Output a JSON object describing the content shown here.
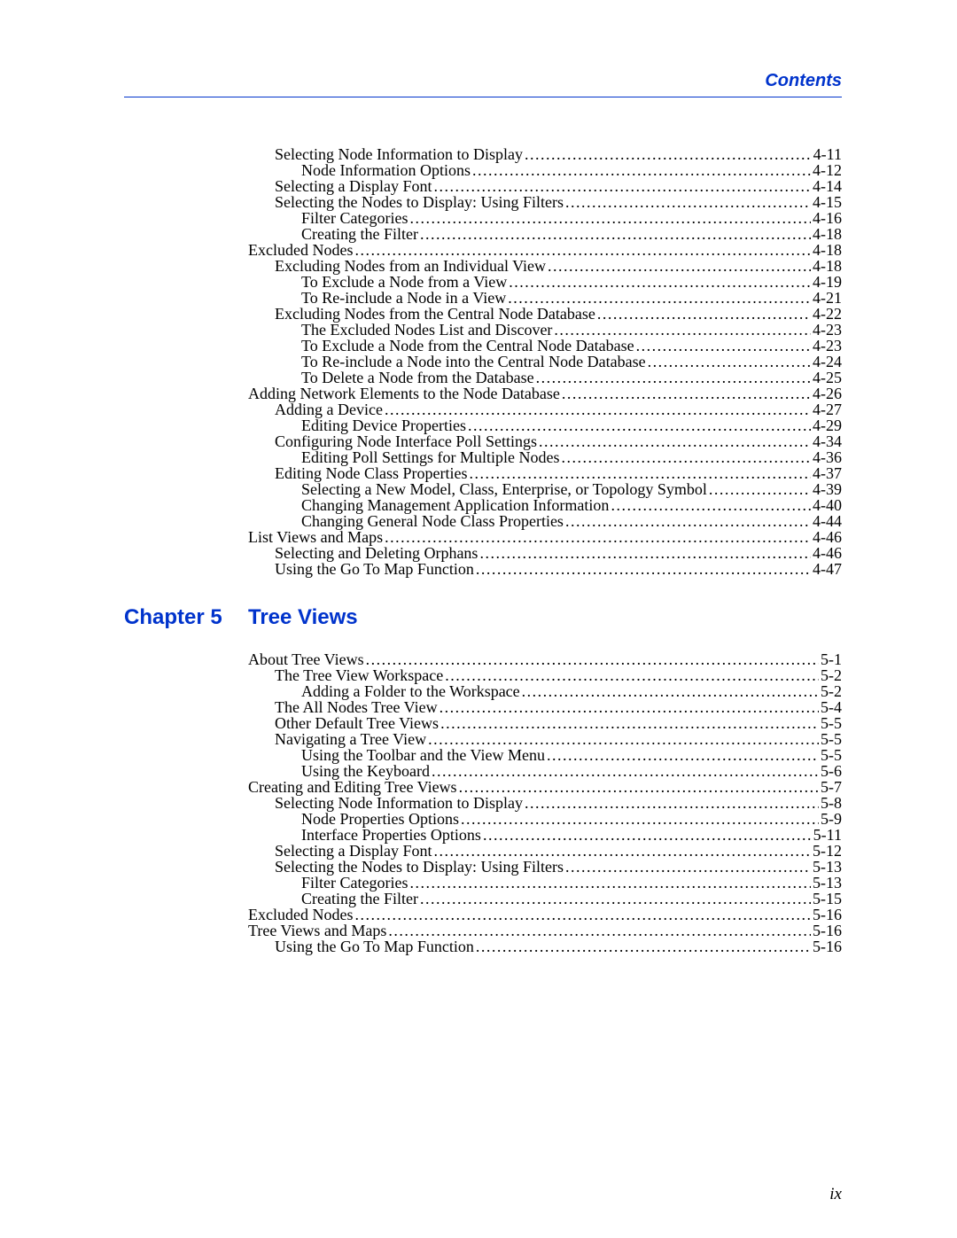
{
  "header": {
    "title": "Contents"
  },
  "footer": {
    "page_number": "ix"
  },
  "section1": {
    "entries": [
      {
        "title": "Selecting Node Information to Display",
        "page": "4-11",
        "indent": 1
      },
      {
        "title": "Node Information Options",
        "page": "4-12",
        "indent": 2
      },
      {
        "title": "Selecting a Display Font",
        "page": "4-14",
        "indent": 1
      },
      {
        "title": "Selecting the Nodes to Display: Using Filters",
        "page": "4-15",
        "indent": 1
      },
      {
        "title": "Filter Categories",
        "page": "4-16",
        "indent": 2
      },
      {
        "title": "Creating the Filter",
        "page": "4-18",
        "indent": 2
      },
      {
        "title": "Excluded Nodes",
        "page": "4-18",
        "indent": 0
      },
      {
        "title": "Excluding Nodes from an Individual View",
        "page": "4-18",
        "indent": 1
      },
      {
        "title": "To Exclude a Node from a View",
        "page": "4-19",
        "indent": 2
      },
      {
        "title": "To Re-include a Node in a View",
        "page": "4-21",
        "indent": 2
      },
      {
        "title": "Excluding Nodes from the Central Node Database",
        "page": "4-22",
        "indent": 1
      },
      {
        "title": "The Excluded Nodes List and Discover",
        "page": "4-23",
        "indent": 2
      },
      {
        "title": "To Exclude a Node from the Central Node Database",
        "page": "4-23",
        "indent": 2
      },
      {
        "title": "To Re-include a Node into the Central Node Database",
        "page": "4-24",
        "indent": 2
      },
      {
        "title": "To Delete a Node from the Database",
        "page": "4-25",
        "indent": 2
      },
      {
        "title": "Adding Network Elements to the Node Database",
        "page": "4-26",
        "indent": 0
      },
      {
        "title": "Adding a Device",
        "page": "4-27",
        "indent": 1
      },
      {
        "title": "Editing Device Properties",
        "page": "4-29",
        "indent": 2
      },
      {
        "title": "Configuring Node Interface Poll Settings",
        "page": "4-34",
        "indent": 1
      },
      {
        "title": "Editing Poll Settings for Multiple Nodes",
        "page": "4-36",
        "indent": 2
      },
      {
        "title": "Editing Node Class Properties",
        "page": "4-37",
        "indent": 1
      },
      {
        "title": "Selecting a New Model, Class, Enterprise, or Topology Symbol",
        "page": "4-39",
        "indent": 2
      },
      {
        "title": "Changing Management Application Information",
        "page": "4-40",
        "indent": 2
      },
      {
        "title": "Changing General Node Class Properties",
        "page": "4-44",
        "indent": 2
      },
      {
        "title": "List Views and Maps",
        "page": "4-46",
        "indent": 0
      },
      {
        "title": "Selecting and Deleting Orphans",
        "page": "4-46",
        "indent": 1
      },
      {
        "title": "Using the Go To Map Function",
        "page": "4-47",
        "indent": 1
      }
    ]
  },
  "chapter5": {
    "label": "Chapter 5",
    "title": "Tree Views"
  },
  "section2": {
    "entries": [
      {
        "title": "About Tree Views",
        "page": "5-1",
        "indent": 0
      },
      {
        "title": "The Tree View Workspace",
        "page": "5-2",
        "indent": 1
      },
      {
        "title": "Adding a Folder to the Workspace",
        "page": "5-2",
        "indent": 2
      },
      {
        "title": "The All Nodes Tree View",
        "page": "5-4",
        "indent": 1
      },
      {
        "title": "Other Default Tree Views",
        "page": "5-5",
        "indent": 1
      },
      {
        "title": "Navigating a Tree View",
        "page": "5-5",
        "indent": 1
      },
      {
        "title": "Using the Toolbar and the View Menu",
        "page": "5-5",
        "indent": 2
      },
      {
        "title": "Using the Keyboard",
        "page": "5-6",
        "indent": 2
      },
      {
        "title": "Creating and Editing Tree Views",
        "page": "5-7",
        "indent": 0
      },
      {
        "title": "Selecting Node Information to Display",
        "page": "5-8",
        "indent": 1
      },
      {
        "title": "Node Properties Options",
        "page": "5-9",
        "indent": 2
      },
      {
        "title": "Interface Properties Options",
        "page": "5-11",
        "indent": 2
      },
      {
        "title": "Selecting a Display Font",
        "page": "5-12",
        "indent": 1
      },
      {
        "title": "Selecting the Nodes to Display: Using Filters",
        "page": "5-13",
        "indent": 1
      },
      {
        "title": "Filter Categories",
        "page": "5-13",
        "indent": 2
      },
      {
        "title": "Creating the Filter",
        "page": "5-15",
        "indent": 2
      },
      {
        "title": "Excluded Nodes",
        "page": "5-16",
        "indent": 0
      },
      {
        "title": "Tree Views and Maps",
        "page": "5-16",
        "indent": 0
      },
      {
        "title": "Using the Go To Map Function",
        "page": "5-16",
        "indent": 1
      }
    ]
  }
}
